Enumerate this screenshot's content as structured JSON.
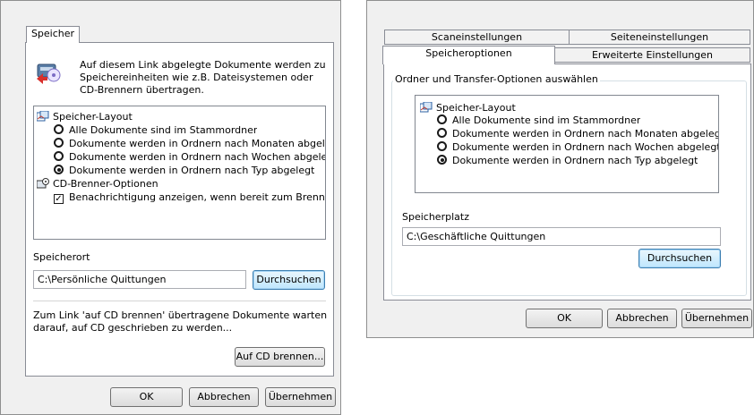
{
  "dialog1": {
    "tab_label": "Speicher",
    "description": [
      "Auf diesem Link abgelegte Dokumente werden zu",
      "Speichereinheiten wie z.B. Dateisystemen oder",
      "CD-Brennern übertragen."
    ],
    "tree": {
      "layout_group": "Speicher-Layout",
      "options": [
        {
          "label": "Alle Dokumente sind im Stammordner",
          "checked": false
        },
        {
          "label": "Dokumente werden in Ordnern nach Monaten abgelec",
          "checked": false
        },
        {
          "label": "Dokumente werden in Ordnern nach Wochen abgeleg",
          "checked": false
        },
        {
          "label": "Dokumente werden in Ordnern nach Typ abgelegt",
          "checked": true
        }
      ],
      "cd_group": "CD-Brenner-Optionen",
      "cd_option": "Benachrichtigung anzeigen, wenn bereit zum Brennen",
      "cd_option_checked": true
    },
    "location_label": "Speicherort",
    "location_value": "C:\\Persönliche Quittungen",
    "browse_button": "Durchsuchen",
    "burn_info": [
      "Zum Link 'auf CD brennen' übertragene Dokumente warten",
      "darauf, auf CD geschrieben zu werden..."
    ],
    "burn_button": "Auf CD brennen...",
    "ok_button": "OK",
    "cancel_button": "Abbrechen",
    "apply_button": "Übernehmen"
  },
  "dialog2": {
    "tabs_back": [
      "Scaneinstellungen",
      "Seiteneinstellungen"
    ],
    "tabs_front": [
      "Speicheroptionen",
      "Erweiterte Einstellungen"
    ],
    "group_title": "Ordner und Transfer-Optionen auswählen",
    "layout_group": "Speicher-Layout",
    "options": [
      {
        "label": "Alle Dokumente sind im Stammordner",
        "checked": false
      },
      {
        "label": "Dokumente werden in Ordnern nach Monaten abgelegt",
        "checked": false
      },
      {
        "label": "Dokumente werden in Ordnern nach Wochen abgelegt",
        "checked": false
      },
      {
        "label": "Dokumente werden in Ordnern nach Typ abgelegt",
        "checked": true
      }
    ],
    "location_label": "Speicherplatz",
    "location_value": "C:\\Geschäftliche Quittungen",
    "browse_button": "Durchsuchen",
    "ok_button": "OK",
    "cancel_button": "Abbrechen",
    "apply_button": "Übernehmen"
  }
}
